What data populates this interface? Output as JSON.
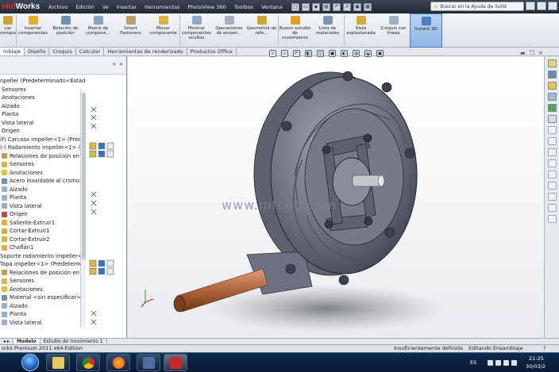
{
  "window": {
    "brand_a": "olid",
    "brand_b": "Works",
    "search_placeholder": "Buscar en la Ayuda de Solid"
  },
  "menu": [
    "Archivo",
    "Edición",
    "Ve",
    "Insertar",
    "Herramientas",
    "PhotoView 360",
    "Toolbox",
    "Ventana"
  ],
  "ribbon": {
    "buttons": [
      {
        "label": "car componente",
        "icon_color": "#d0a038"
      },
      {
        "label": "Insertar componentes",
        "icon_color": "#e0b030"
      },
      {
        "label": "Relación de posición",
        "icon_color": "#6e8fb8"
      },
      {
        "label": "Matriz de compone...",
        "icon_color": "#8aa2c2"
      },
      {
        "label": "Smart Fasteners",
        "icon_color": "#b9a06a"
      },
      {
        "label": "Mover componente",
        "icon_color": "#d8b440"
      },
      {
        "label": "Mostrar componentes ocultos",
        "icon_color": "#90a8c8"
      },
      {
        "label": "Operaciones de ensam...",
        "icon_color": "#a0b0c4"
      },
      {
        "label": "Geometría de refe...",
        "icon_color": "#c8a838"
      },
      {
        "label": "Nuevo estudio de movimiento",
        "icon_color": "#e0a030"
      },
      {
        "label": "Lista de materiales",
        "icon_color": "#7f94ad"
      },
      {
        "label": "Vista explosionada",
        "icon_color": "#d4ac3a"
      },
      {
        "label": "Croquis con líneas",
        "icon_color": "#9fb0c2"
      },
      {
        "label": "Instant 3D",
        "icon_color": "#4a7ec0"
      }
    ]
  },
  "tabs": [
    "mblaje",
    "Diseño",
    "Croquis",
    "Calcular",
    "Herramientas de renderizado",
    "Productos Office"
  ],
  "tree": {
    "items": [
      {
        "label": "npeller (Predeterminado<Estado d",
        "icon_color": "#ffffff"
      },
      {
        "label": "Sensores",
        "icon_color": "#ffffff"
      },
      {
        "label": "Anotaciones",
        "icon_color": "#ffffff"
      },
      {
        "label": "Alzado",
        "icon_color": "#ffffff"
      },
      {
        "label": "Planta",
        "icon_color": "#ffffff"
      },
      {
        "label": "Vista lateral",
        "icon_color": "#ffffff"
      },
      {
        "label": "Origen",
        "icon_color": "#ffffff"
      },
      {
        "label": "(f) Carcasa impeller<1> (Predetermi",
        "icon_color": "#ffffff"
      },
      {
        "label": "(-) Rodamiento impeller<1> (Pr",
        "icon_color": "#ffffff"
      },
      {
        "label": "Relaciones de posición en Im",
        "icon_color": "#c0a050"
      },
      {
        "label": "Sensores",
        "icon_color": "#d8b848"
      },
      {
        "label": "Anotaciones",
        "icon_color": "#e0c040"
      },
      {
        "label": "Acero inoxidable al cromo",
        "icon_color": "#7a8ca8"
      },
      {
        "label": "Alzado",
        "icon_color": "#9bb0c8"
      },
      {
        "label": "Planta",
        "icon_color": "#9bb0c8"
      },
      {
        "label": "Vista lateral",
        "icon_color": "#9bb0c8"
      },
      {
        "label": "Origen",
        "icon_color": "#b05050"
      },
      {
        "label": "Saliente-Extruir1",
        "icon_color": "#d8b040"
      },
      {
        "label": "Cortar-Extruir1",
        "icon_color": "#d8b040"
      },
      {
        "label": "Cortar-Extruir2",
        "icon_color": "#d8b040"
      },
      {
        "label": "Chaflán1",
        "icon_color": "#d8b040"
      },
      {
        "label": "Soporte rodamiento impeller<1",
        "icon_color": "#ffffff"
      },
      {
        "label": "Tapa impeller<1> (Predetermin",
        "icon_color": "#ffffff"
      },
      {
        "label": "Relaciones de posición en In",
        "icon_color": "#c0a050"
      },
      {
        "label": "Sensores",
        "icon_color": "#d8b848"
      },
      {
        "label": "Anotaciones",
        "icon_color": "#e0c040"
      },
      {
        "label": "Material <sin especificar>",
        "icon_color": "#7a8ca8"
      },
      {
        "label": "Alzado",
        "icon_color": "#9bb0c8"
      },
      {
        "label": "Planta",
        "icon_color": "#9bb0c8"
      },
      {
        "label": "Vista lateral",
        "icon_color": "#9bb0c8"
      }
    ]
  },
  "bottom_tabs": [
    "Modelo",
    "Estudio de movimiento 1"
  ],
  "status": {
    "edition": "orks Premium 2011 x64 Edition",
    "definition": "Insuficientemente definida",
    "mode": "Editando Ensamblaje"
  },
  "watermark": "www.mfcad.com",
  "taskbar": {
    "lang": "ES",
    "time": "21:25",
    "date": "30/03/2"
  },
  "colors": {
    "housing": "#6f7381",
    "pipe": "#b0623a",
    "accent": "#3c72c4"
  }
}
